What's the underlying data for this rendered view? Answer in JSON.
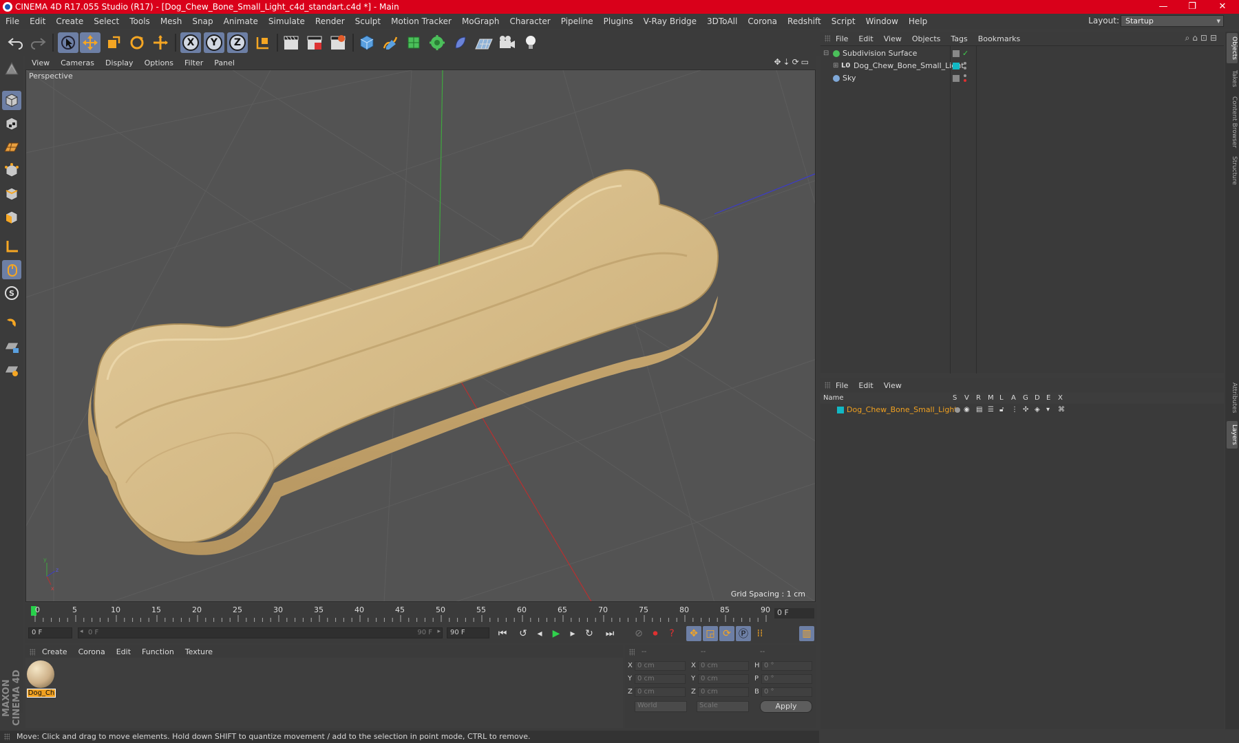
{
  "window": {
    "title": "CINEMA 4D R17.055 Studio (R17) - [Dog_Chew_Bone_Small_Light_c4d_standart.c4d *] - Main",
    "minimize": "—",
    "maximize": "❐",
    "close": "✕"
  },
  "menubar": {
    "items": [
      "File",
      "Edit",
      "Create",
      "Select",
      "Tools",
      "Mesh",
      "Snap",
      "Animate",
      "Simulate",
      "Render",
      "Sculpt",
      "Motion Tracker",
      "MoGraph",
      "Character",
      "Pipeline",
      "Plugins",
      "V-Ray Bridge",
      "3DToAll",
      "Corona",
      "Redshift",
      "Script",
      "Window",
      "Help"
    ],
    "layout_label": "Layout:",
    "layout_value": "Startup"
  },
  "toolbar": {
    "axis_x": "X",
    "axis_y": "Y",
    "axis_z": "Z"
  },
  "viewport": {
    "menu": [
      "View",
      "Cameras",
      "Display",
      "Options",
      "Filter",
      "Panel"
    ],
    "label": "Perspective",
    "grid_spacing": "Grid Spacing : 1 cm"
  },
  "timeline": {
    "ticks": [
      "0",
      "5",
      "10",
      "15",
      "20",
      "25",
      "30",
      "35",
      "40",
      "45",
      "50",
      "55",
      "60",
      "65",
      "70",
      "75",
      "80",
      "85",
      "90"
    ],
    "current_frame": "0 F"
  },
  "playback": {
    "start": "0 F",
    "range_start": "0 F",
    "range_end": "90 F",
    "end": "90 F"
  },
  "material_manager": {
    "menu": [
      "Create",
      "Corona",
      "Edit",
      "Function",
      "Texture"
    ],
    "material_name": "Dog_Ch"
  },
  "coordinates": {
    "headers": [
      "--",
      "--",
      "--"
    ],
    "rows": [
      {
        "axis": "X",
        "pos": "0 cm",
        "axis2": "X",
        "size": "0 cm",
        "axis3": "H",
        "rot": "0 °"
      },
      {
        "axis": "Y",
        "pos": "0 cm",
        "axis2": "Y",
        "size": "0 cm",
        "axis3": "P",
        "rot": "0 °"
      },
      {
        "axis": "Z",
        "pos": "0 cm",
        "axis2": "Z",
        "size": "0 cm",
        "axis3": "B",
        "rot": "0 °"
      }
    ],
    "mode": "World",
    "scale": "Scale",
    "apply": "Apply"
  },
  "statusbar": {
    "text": "Move: Click and drag to move elements. Hold down SHIFT to quantize movement / add to the selection in point mode, CTRL to remove."
  },
  "object_manager": {
    "menu": [
      "File",
      "Edit",
      "View",
      "Objects",
      "Tags",
      "Bookmarks"
    ],
    "objects": [
      {
        "name": "Subdivision Surface"
      },
      {
        "name": "Dog_Chew_Bone_Small_Light"
      },
      {
        "name": "Sky"
      }
    ]
  },
  "layer_manager": {
    "menu": [
      "File",
      "Edit",
      "View"
    ],
    "columns": [
      "Name",
      "S",
      "V",
      "R",
      "M",
      "L",
      "A",
      "G",
      "D",
      "E",
      "X"
    ],
    "layers": [
      {
        "name": "Dog_Chew_Bone_Small_Light"
      }
    ]
  },
  "right_tabs": [
    "Objects",
    "Takes",
    "Content Browser",
    "Structure",
    "Attributes",
    "Layers"
  ],
  "branding": {
    "logo": "MAXON CINEMA 4D"
  },
  "colors": {
    "titlebar": "#d9001a",
    "active_tool": "#6d7fa5",
    "layer_color": "#12b8c4",
    "selected_text": "#f0a020",
    "bone": "#d4b887"
  }
}
